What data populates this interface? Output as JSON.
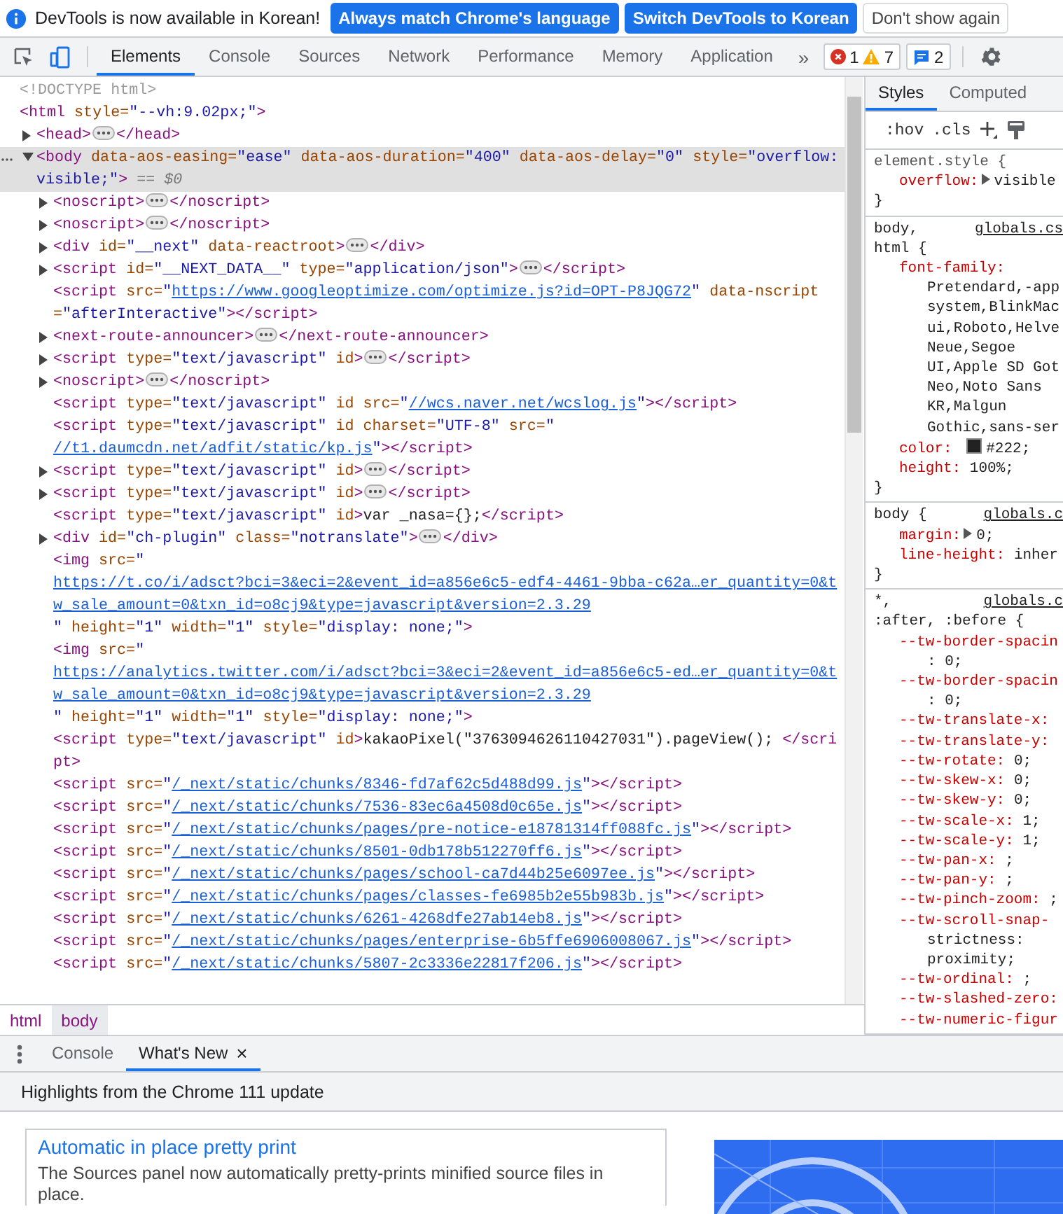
{
  "infobar": {
    "message": "DevTools is now available in Korean!",
    "buttons": [
      {
        "label": "Always match Chrome's language",
        "kind": "primary"
      },
      {
        "label": "Switch DevTools to Korean",
        "kind": "primary"
      },
      {
        "label": "Don't show again",
        "kind": "secondary"
      }
    ]
  },
  "toolbar": {
    "tabs": [
      {
        "label": "Elements",
        "selected": true
      },
      {
        "label": "Console",
        "selected": false
      },
      {
        "label": "Sources",
        "selected": false
      },
      {
        "label": "Network",
        "selected": false
      },
      {
        "label": "Performance",
        "selected": false
      },
      {
        "label": "Memory",
        "selected": false
      },
      {
        "label": "Application",
        "selected": false
      }
    ],
    "more_tabs": "»",
    "errors": "1",
    "warnings": "7",
    "issues": "2"
  },
  "dom": [
    {
      "selected": false,
      "parts": [
        {
          "kind": "doctype",
          "text": "<!DOCTYPE html>"
        }
      ]
    },
    {
      "selected": false,
      "parts": [
        {
          "kind": "tag",
          "text": "<html"
        },
        {
          "kind": "attr",
          "text": " style="
        },
        {
          "kind": "value",
          "text": "\"--vh:9.02px;\""
        },
        {
          "kind": "tag",
          "text": ">"
        }
      ],
      "children": [
        {
          "expanded": false,
          "selected": false,
          "parts": [
            {
              "kind": "tag",
              "text": "<head>"
            },
            {
              "kind": "ellipsis"
            },
            {
              "kind": "tag",
              "text": "</head>"
            }
          ]
        },
        {
          "expanded": true,
          "selected": true,
          "parts": [
            {
              "kind": "tag",
              "text": "<body"
            },
            {
              "kind": "attr",
              "text": " data-aos-easing="
            },
            {
              "kind": "value",
              "text": "\"ease\""
            },
            {
              "kind": "attr",
              "text": " data-aos-duration="
            },
            {
              "kind": "value",
              "text": "\"400\""
            },
            {
              "kind": "attr",
              "text": " data-aos-delay="
            },
            {
              "kind": "value",
              "text": "\"0\""
            },
            {
              "kind": "attr",
              "text": " style="
            },
            {
              "kind": "value",
              "text": "\"overflow: visible;\""
            },
            {
              "kind": "tag",
              "text": ">"
            },
            {
              "kind": "marker",
              "text": " == $0"
            }
          ],
          "children": [
            {
              "expanded": false,
              "selected": false,
              "parts": [
                {
                  "kind": "tag",
                  "text": "<noscript>"
                },
                {
                  "kind": "ellipsis"
                },
                {
                  "kind": "tag",
                  "text": "</noscript>"
                }
              ]
            },
            {
              "expanded": false,
              "selected": false,
              "parts": [
                {
                  "kind": "tag",
                  "text": "<noscript>"
                },
                {
                  "kind": "ellipsis"
                },
                {
                  "kind": "tag",
                  "text": "</noscript>"
                }
              ]
            },
            {
              "expanded": false,
              "selected": false,
              "parts": [
                {
                  "kind": "tag",
                  "text": "<div"
                },
                {
                  "kind": "attr",
                  "text": " id="
                },
                {
                  "kind": "value",
                  "text": "\"__next\""
                },
                {
                  "kind": "attr",
                  "text": " data-reactroot"
                },
                {
                  "kind": "tag",
                  "text": ">"
                },
                {
                  "kind": "ellipsis"
                },
                {
                  "kind": "tag",
                  "text": "</div>"
                }
              ]
            },
            {
              "expanded": false,
              "selected": false,
              "parts": [
                {
                  "kind": "tag",
                  "text": "<script"
                },
                {
                  "kind": "attr",
                  "text": " id="
                },
                {
                  "kind": "value",
                  "text": "\"__NEXT_DATA__\""
                },
                {
                  "kind": "attr",
                  "text": " type="
                },
                {
                  "kind": "value",
                  "text": "\"application/json\""
                },
                {
                  "kind": "tag",
                  "text": ">"
                },
                {
                  "kind": "ellipsis"
                },
                {
                  "kind": "tag",
                  "text": "</script>"
                }
              ]
            },
            {
              "selected": false,
              "parts": [
                {
                  "kind": "tag",
                  "text": "<script"
                },
                {
                  "kind": "attr",
                  "text": " src="
                },
                {
                  "kind": "value",
                  "text": "\""
                },
                {
                  "kind": "link",
                  "text": "https://www.googleoptimize.com/optimize.js?id=OPT-P8JQG72"
                },
                {
                  "kind": "value",
                  "text": "\""
                },
                {
                  "kind": "attr",
                  "text": " data-nscript="
                },
                {
                  "kind": "value",
                  "text": "\"afterInteractive\""
                },
                {
                  "kind": "tag",
                  "text": "></script>"
                }
              ]
            },
            {
              "expanded": false,
              "selected": false,
              "parts": [
                {
                  "kind": "tag",
                  "text": "<next-route-announcer>"
                },
                {
                  "kind": "ellipsis"
                },
                {
                  "kind": "tag",
                  "text": "</next-route-announcer>"
                }
              ]
            },
            {
              "expanded": false,
              "selected": false,
              "parts": [
                {
                  "kind": "tag",
                  "text": "<script"
                },
                {
                  "kind": "attr",
                  "text": " type="
                },
                {
                  "kind": "value",
                  "text": "\"text/javascript\""
                },
                {
                  "kind": "attr",
                  "text": " id"
                },
                {
                  "kind": "tag",
                  "text": ">"
                },
                {
                  "kind": "ellipsis"
                },
                {
                  "kind": "tag",
                  "text": "</script>"
                }
              ]
            },
            {
              "expanded": false,
              "selected": false,
              "parts": [
                {
                  "kind": "tag",
                  "text": "<noscript>"
                },
                {
                  "kind": "ellipsis"
                },
                {
                  "kind": "tag",
                  "text": "</noscript>"
                }
              ]
            },
            {
              "selected": false,
              "parts": [
                {
                  "kind": "tag",
                  "text": "<script"
                },
                {
                  "kind": "attr",
                  "text": " type="
                },
                {
                  "kind": "value",
                  "text": "\"text/javascript\""
                },
                {
                  "kind": "attr",
                  "text": " id src="
                },
                {
                  "kind": "value",
                  "text": "\""
                },
                {
                  "kind": "link",
                  "text": "//wcs.naver.net/wcslog.js"
                },
                {
                  "kind": "value",
                  "text": "\""
                },
                {
                  "kind": "tag",
                  "text": "></script>"
                }
              ]
            },
            {
              "selected": false,
              "parts": [
                {
                  "kind": "tag",
                  "text": "<script"
                },
                {
                  "kind": "attr",
                  "text": " type="
                },
                {
                  "kind": "value",
                  "text": "\"text/javascript\""
                },
                {
                  "kind": "attr",
                  "text": " id charset="
                },
                {
                  "kind": "value",
                  "text": "\"UTF-8\""
                },
                {
                  "kind": "attr",
                  "text": " src="
                },
                {
                  "kind": "value",
                  "text": "\""
                },
                {
                  "kind": "link",
                  "text": "//t1.daumcdn.net/adfit/static/kp.js"
                },
                {
                  "kind": "value",
                  "text": "\""
                },
                {
                  "kind": "tag",
                  "text": "></script>"
                }
              ]
            },
            {
              "expanded": false,
              "selected": false,
              "parts": [
                {
                  "kind": "tag",
                  "text": "<script"
                },
                {
                  "kind": "attr",
                  "text": " type="
                },
                {
                  "kind": "value",
                  "text": "\"text/javascript\""
                },
                {
                  "kind": "attr",
                  "text": " id"
                },
                {
                  "kind": "tag",
                  "text": ">"
                },
                {
                  "kind": "ellipsis"
                },
                {
                  "kind": "tag",
                  "text": "</script>"
                }
              ]
            },
            {
              "expanded": false,
              "selected": false,
              "parts": [
                {
                  "kind": "tag",
                  "text": "<script"
                },
                {
                  "kind": "attr",
                  "text": " type="
                },
                {
                  "kind": "value",
                  "text": "\"text/javascript\""
                },
                {
                  "kind": "attr",
                  "text": " id"
                },
                {
                  "kind": "tag",
                  "text": ">"
                },
                {
                  "kind": "ellipsis"
                },
                {
                  "kind": "tag",
                  "text": "</script>"
                }
              ]
            },
            {
              "selected": false,
              "parts": [
                {
                  "kind": "tag",
                  "text": "<script"
                },
                {
                  "kind": "attr",
                  "text": " type="
                },
                {
                  "kind": "value",
                  "text": "\"text/javascript\""
                },
                {
                  "kind": "attr",
                  "text": " id"
                },
                {
                  "kind": "tag",
                  "text": ">"
                },
                {
                  "kind": "text",
                  "text": "var _nasa={};"
                },
                {
                  "kind": "tag",
                  "text": "</script>"
                }
              ]
            },
            {
              "expanded": false,
              "selected": false,
              "parts": [
                {
                  "kind": "tag",
                  "text": "<div"
                },
                {
                  "kind": "attr",
                  "text": " id="
                },
                {
                  "kind": "value",
                  "text": "\"ch-plugin\""
                },
                {
                  "kind": "attr",
                  "text": " class="
                },
                {
                  "kind": "value",
                  "text": "\"notranslate\""
                },
                {
                  "kind": "tag",
                  "text": ">"
                },
                {
                  "kind": "ellipsis"
                },
                {
                  "kind": "tag",
                  "text": "</div>"
                }
              ]
            },
            {
              "selected": false,
              "parts": [
                {
                  "kind": "tag",
                  "text": "<img"
                },
                {
                  "kind": "attr",
                  "text": " src="
                },
                {
                  "kind": "value",
                  "text": "\""
                },
                {
                  "kind": "link",
                  "text": "https://t.co/i/adsct?bci=3&eci=2&event_id=a856e6c5-edf4-4461-9bba-c62a…er_quantity=0&tw_sale_amount=0&txn_id=o8cj9&type=javascript&version=2.3.29"
                },
                {
                  "kind": "value",
                  "text": "\""
                },
                {
                  "kind": "attr",
                  "text": " height="
                },
                {
                  "kind": "value",
                  "text": "\"1\""
                },
                {
                  "kind": "attr",
                  "text": " width="
                },
                {
                  "kind": "value",
                  "text": "\"1\""
                },
                {
                  "kind": "attr",
                  "text": " style="
                },
                {
                  "kind": "value",
                  "text": "\"display: none;\""
                },
                {
                  "kind": "tag",
                  "text": ">"
                }
              ]
            },
            {
              "selected": false,
              "parts": [
                {
                  "kind": "tag",
                  "text": "<img"
                },
                {
                  "kind": "attr",
                  "text": " src="
                },
                {
                  "kind": "value",
                  "text": "\""
                },
                {
                  "kind": "link",
                  "text": "https://analytics.twitter.com/i/adsct?bci=3&eci=2&event_id=a856e6c5-ed…er_quantity=0&tw_sale_amount=0&txn_id=o8cj9&type=javascript&version=2.3.29"
                },
                {
                  "kind": "value",
                  "text": "\""
                },
                {
                  "kind": "attr",
                  "text": " height="
                },
                {
                  "kind": "value",
                  "text": "\"1\""
                },
                {
                  "kind": "attr",
                  "text": " width="
                },
                {
                  "kind": "value",
                  "text": "\"1\""
                },
                {
                  "kind": "attr",
                  "text": " style="
                },
                {
                  "kind": "value",
                  "text": "\"display: none;\""
                },
                {
                  "kind": "tag",
                  "text": ">"
                }
              ]
            },
            {
              "selected": false,
              "parts": [
                {
                  "kind": "tag",
                  "text": "<script"
                },
                {
                  "kind": "attr",
                  "text": " type="
                },
                {
                  "kind": "value",
                  "text": "\"text/javascript\""
                },
                {
                  "kind": "attr",
                  "text": " id"
                },
                {
                  "kind": "tag",
                  "text": ">"
                },
                {
                  "kind": "text",
                  "text": "kakaoPixel(\"3763094626110427031\").pageView(); "
                },
                {
                  "kind": "tag",
                  "text": "</script>"
                }
              ]
            },
            {
              "selected": false,
              "parts": [
                {
                  "kind": "tag",
                  "text": "<script"
                },
                {
                  "kind": "attr",
                  "text": " src="
                },
                {
                  "kind": "value",
                  "text": "\""
                },
                {
                  "kind": "link",
                  "text": "/_next/static/chunks/8346-fd7af62c5d488d99.js"
                },
                {
                  "kind": "value",
                  "text": "\""
                },
                {
                  "kind": "tag",
                  "text": "></script>"
                }
              ]
            },
            {
              "selected": false,
              "parts": [
                {
                  "kind": "tag",
                  "text": "<script"
                },
                {
                  "kind": "attr",
                  "text": " src="
                },
                {
                  "kind": "value",
                  "text": "\""
                },
                {
                  "kind": "link",
                  "text": "/_next/static/chunks/7536-83ec6a4508d0c65e.js"
                },
                {
                  "kind": "value",
                  "text": "\""
                },
                {
                  "kind": "tag",
                  "text": "></script>"
                }
              ]
            },
            {
              "selected": false,
              "parts": [
                {
                  "kind": "tag",
                  "text": "<script"
                },
                {
                  "kind": "attr",
                  "text": " src="
                },
                {
                  "kind": "value",
                  "text": "\""
                },
                {
                  "kind": "link",
                  "text": "/_next/static/chunks/pages/pre-notice-e18781314ff088fc.js"
                },
                {
                  "kind": "value",
                  "text": "\""
                },
                {
                  "kind": "tag",
                  "text": "></script>"
                }
              ]
            },
            {
              "selected": false,
              "parts": [
                {
                  "kind": "tag",
                  "text": "<script"
                },
                {
                  "kind": "attr",
                  "text": " src="
                },
                {
                  "kind": "value",
                  "text": "\""
                },
                {
                  "kind": "link",
                  "text": "/_next/static/chunks/8501-0db178b512270ff6.js"
                },
                {
                  "kind": "value",
                  "text": "\""
                },
                {
                  "kind": "tag",
                  "text": "></script>"
                }
              ]
            },
            {
              "selected": false,
              "parts": [
                {
                  "kind": "tag",
                  "text": "<script"
                },
                {
                  "kind": "attr",
                  "text": " src="
                },
                {
                  "kind": "value",
                  "text": "\""
                },
                {
                  "kind": "link",
                  "text": "/_next/static/chunks/pages/school-ca7d44b25e6097ee.js"
                },
                {
                  "kind": "value",
                  "text": "\""
                },
                {
                  "kind": "tag",
                  "text": "></script>"
                }
              ]
            },
            {
              "selected": false,
              "parts": [
                {
                  "kind": "tag",
                  "text": "<script"
                },
                {
                  "kind": "attr",
                  "text": " src="
                },
                {
                  "kind": "value",
                  "text": "\""
                },
                {
                  "kind": "link",
                  "text": "/_next/static/chunks/pages/classes-fe6985b2e55b983b.js"
                },
                {
                  "kind": "value",
                  "text": "\""
                },
                {
                  "kind": "tag",
                  "text": "></script>"
                }
              ]
            },
            {
              "selected": false,
              "parts": [
                {
                  "kind": "tag",
                  "text": "<script"
                },
                {
                  "kind": "attr",
                  "text": " src="
                },
                {
                  "kind": "value",
                  "text": "\""
                },
                {
                  "kind": "link",
                  "text": "/_next/static/chunks/6261-4268dfe27ab14eb8.js"
                },
                {
                  "kind": "value",
                  "text": "\""
                },
                {
                  "kind": "tag",
                  "text": "></script>"
                }
              ]
            },
            {
              "selected": false,
              "parts": [
                {
                  "kind": "tag",
                  "text": "<script"
                },
                {
                  "kind": "attr",
                  "text": " src="
                },
                {
                  "kind": "value",
                  "text": "\""
                },
                {
                  "kind": "link",
                  "text": "/_next/static/chunks/pages/enterprise-6b5ffe6906008067.js"
                },
                {
                  "kind": "value",
                  "text": "\""
                },
                {
                  "kind": "tag",
                  "text": "></script>"
                }
              ]
            },
            {
              "selected": false,
              "parts": [
                {
                  "kind": "tag",
                  "text": "<script"
                },
                {
                  "kind": "attr",
                  "text": " src="
                },
                {
                  "kind": "value",
                  "text": "\""
                },
                {
                  "kind": "link",
                  "text": "/_next/static/chunks/5807-2c3336e22817f206.js"
                },
                {
                  "kind": "value",
                  "text": "\""
                },
                {
                  "kind": "tag",
                  "text": "></script>"
                }
              ]
            }
          ]
        }
      ]
    }
  ],
  "styles": {
    "tabs": [
      {
        "label": "Styles",
        "selected": true
      },
      {
        "label": "Computed",
        "selected": false
      }
    ],
    "hov": ":hov",
    "cls": ".cls",
    "rules": [
      {
        "selector_lines": [
          "element.style {"
        ],
        "inline": true,
        "properties": [
          {
            "name": "overflow:",
            "expander": true,
            "value": "visible"
          }
        ],
        "close": "}"
      },
      {
        "selector_lines": [
          "body,",
          "html {"
        ],
        "inline": false,
        "source": "globals.cs",
        "properties": [
          {
            "name": "font-family:",
            "value_lines": [
              "Pretendard,-app",
              "system,BlinkMac",
              "ui,Roboto,Helve",
              "Neue,Segoe",
              "UI,Apple SD Got",
              "Neo,Noto Sans",
              "KR,Malgun",
              "Gothic,sans-ser"
            ]
          },
          {
            "name": "color:",
            "color": "#222222",
            "value": "#222;"
          },
          {
            "name": "height:",
            "value": "100%;"
          }
        ],
        "close": "}"
      },
      {
        "selector_lines": [
          "body {"
        ],
        "inline": false,
        "source": "globals.c",
        "properties": [
          {
            "name": "margin:",
            "expander": true,
            "value": "0;"
          },
          {
            "name": "line-height:",
            "value": "inher"
          }
        ],
        "close": "}"
      },
      {
        "selector_lines": [
          "*,",
          ":after, :before {"
        ],
        "inline": false,
        "source": "globals.c",
        "properties": [
          {
            "name": "--tw-border-spacin",
            "value_lines": [
              ": 0;"
            ]
          },
          {
            "name": "--tw-border-spacin",
            "value_lines": [
              ": 0;"
            ]
          },
          {
            "name": "--tw-translate-x:"
          },
          {
            "name": "--tw-translate-y:"
          },
          {
            "name": "--tw-rotate:",
            "value": "0;"
          },
          {
            "name": "--tw-skew-x:",
            "value": "0;"
          },
          {
            "name": "--tw-skew-y:",
            "value": "0;"
          },
          {
            "name": "--tw-scale-x:",
            "value": "1;"
          },
          {
            "name": "--tw-scale-y:",
            "value": "1;"
          },
          {
            "name": "--tw-pan-x:",
            "value": ";"
          },
          {
            "name": "--tw-pan-y:",
            "value": ";"
          },
          {
            "name": "--tw-pinch-zoom:",
            "value": ";"
          },
          {
            "name": "--tw-scroll-snap-",
            "value_lines": [
              "strictness:",
              "proximity;"
            ]
          },
          {
            "name": "--tw-ordinal:",
            "value": ";"
          },
          {
            "name": "--tw-slashed-zero:"
          },
          {
            "name": "--tw-numeric-figur"
          }
        ]
      }
    ]
  },
  "breadcrumbs": [
    {
      "label": "html",
      "selected": false
    },
    {
      "label": "body",
      "selected": true
    }
  ],
  "drawer": {
    "tabs": [
      {
        "label": "Console",
        "selected": false,
        "closable": false
      },
      {
        "label": "What's New",
        "selected": true,
        "closable": true
      }
    ],
    "close_glyph": "×",
    "heading": "Highlights from the Chrome 111 update",
    "card": {
      "title": "Automatic in place pretty print",
      "text": "The Sources panel now automatically pretty-prints minified source files in place."
    }
  }
}
